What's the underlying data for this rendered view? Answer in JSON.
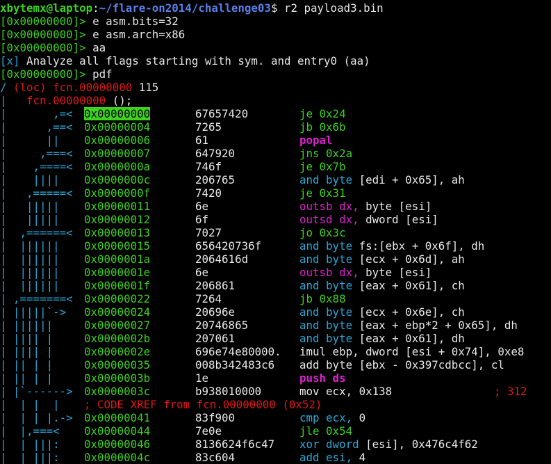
{
  "shell": {
    "user_host": "xbytemx@laptop",
    "colon": ":",
    "path": "~/flare-on2014/challenge03",
    "dollar": "$ ",
    "command": "r2 payload3.bin"
  },
  "r2": {
    "prompt_addr": "[0x00000000]>",
    "cmd1": " e asm.bits=32",
    "cmd2": " e asm.arch=x86",
    "cmd3": " aa",
    "analyze_tag": "[x]",
    "analyze_msg": " Analyze all flags starting with sym. and entry0 (aa)",
    "cmd4": " pdf"
  },
  "function": {
    "header_slash": "/ ",
    "header_loc": "(loc) fcn.00000000",
    "header_size": " 115",
    "sig_pipe": "|   ",
    "sig_name": "fcn.00000000",
    "sig_rest": " ();"
  },
  "listing": [
    {
      "art": "|       ,=< ",
      "addr": "0x00000000",
      "hl": true,
      "bytes": "67657420",
      "mn": "je 0x24",
      "mc": "jmp",
      "op": ""
    },
    {
      "art": "|      ,==< ",
      "addr": "0x00000004",
      "bytes": "7265",
      "mn": "jb 0x6b",
      "mc": "jmp",
      "op": ""
    },
    {
      "art": "|      ||   ",
      "addr": "0x00000006",
      "bytes": "61",
      "mn": "popal",
      "mc": "pink",
      "op": ""
    },
    {
      "art": "|     ,===< ",
      "addr": "0x00000007",
      "bytes": "647920",
      "mn": "jns 0x2a",
      "mc": "jmp",
      "op": ""
    },
    {
      "art": "|    ,====< ",
      "addr": "0x0000000a",
      "bytes": "746f",
      "mn": "je 0x7b",
      "mc": "jmp",
      "op": ""
    },
    {
      "art": "|    ||||   ",
      "addr": "0x0000000c",
      "bytes": "206765",
      "mn": "and byte",
      "mc": "",
      "op": " [edi + 0x65], ah"
    },
    {
      "art": "|   ,=====< ",
      "addr": "0x0000000f",
      "bytes": "7420",
      "mn": "je 0x31",
      "mc": "jmp",
      "op": ""
    },
    {
      "art": "|   |||||   ",
      "addr": "0x00000011",
      "bytes": "6e",
      "mn": "outsb dx,",
      "mc": "pink2",
      "op": " byte [esi]"
    },
    {
      "art": "|   |||||   ",
      "addr": "0x00000012",
      "bytes": "6f",
      "mn": "outsd dx,",
      "mc": "pink2",
      "op": " dword [esi]"
    },
    {
      "art": "|  ,======< ",
      "addr": "0x00000013",
      "bytes": "7027",
      "mn": "jo 0x3c",
      "mc": "jmp",
      "op": ""
    },
    {
      "art": "|  ||||||   ",
      "addr": "0x00000015",
      "bytes": "656420736f",
      "mn": "and byte",
      "mc": "",
      "op": " fs:[ebx + 0x6f], dh"
    },
    {
      "art": "|  ||||||   ",
      "addr": "0x0000001a",
      "bytes": "2064616d",
      "mn": "and byte",
      "mc": "",
      "op": " [ecx + 0x6d], ah"
    },
    {
      "art": "|  ||||||   ",
      "addr": "0x0000001e",
      "bytes": "6e",
      "mn": "outsb dx,",
      "mc": "pink2",
      "op": " byte [esi]"
    },
    {
      "art": "|  ||||||   ",
      "addr": "0x0000001f",
      "bytes": "206861",
      "mn": "and byte",
      "mc": "",
      "op": " [eax + 0x61], ch"
    },
    {
      "art": "| ,=======< ",
      "addr": "0x00000022",
      "bytes": "7264",
      "mn": "jb 0x88",
      "mc": "jmp",
      "op": ""
    },
    {
      "art": "| |||||`-> ",
      "addr": "0x00000024",
      "bytes": "20696e",
      "mn": "and byte",
      "mc": "",
      "op": " [ecx + 0x6e], ch"
    },
    {
      "art": "| ||||||    ",
      "addr": "0x00000027",
      "bytes": "20746865",
      "mn": "and byte",
      "mc": "",
      "op": " [eax + ebp*2 + 0x65], dh"
    },
    {
      "art": "| |||| |    ",
      "addr": "0x0000002b",
      "bytes": "207061",
      "mn": "and byte",
      "mc": "",
      "op": " [eax + 0x61], dh"
    },
    {
      "art": "| |||| |    ",
      "addr": "0x0000002e",
      "bytes": "696e74e80000.",
      "mn": "imul ebp,",
      "mc": "plain",
      "op": " dword [esi + 0x74], 0xe8"
    },
    {
      "art": "| || | |    ",
      "addr": "0x00000035",
      "bytes": "008b342483c6",
      "mn": "add byte",
      "mc": "plain",
      "op": " [ebx - 0x397cdbcc], cl"
    },
    {
      "art": "| || | |    ",
      "addr": "0x0000003b",
      "bytes": "1e",
      "mn": "push ds",
      "mc": "pink3",
      "op": ""
    },
    {
      "art": "| |`------> ",
      "addr": "0x0000003c",
      "bytes": "b938010000",
      "mn": "mov ecx,",
      "mc": "plain",
      "op": " 0x138",
      "comment": "; 312"
    },
    {
      "art": "|  | |  |   ",
      "xref": "; CODE XREF from fcn.00000000 (0x52)"
    },
    {
      "art": "|  | | |.-> ",
      "addr": "0x00000041",
      "bytes": "83f900",
      "mn": "cmp ecx,",
      "mc": "",
      "op": " 0"
    },
    {
      "art": "|  |,===< ",
      "addr": "0x00000044",
      "bytes": "7e0e",
      "mn": "jle 0x54",
      "mc": "jmp",
      "op": ""
    },
    {
      "art": "|  | |||:   ",
      "addr": "0x00000046",
      "bytes": "8136624f6c47",
      "mn": "xor dword",
      "mc": "",
      "op": " [esi], 0x476c4f62"
    },
    {
      "art": "|  | |||:   ",
      "addr": "0x0000004c",
      "bytes": "83c604",
      "mn": "add esi,",
      "mc": "",
      "op": " 4"
    }
  ],
  "colors": {
    "background": "#000000",
    "green": "#3cd21e",
    "cyan": "#2aa8d8",
    "magenta": "#e020d0",
    "red": "#e01818",
    "blue_path": "#5a7fe8"
  }
}
